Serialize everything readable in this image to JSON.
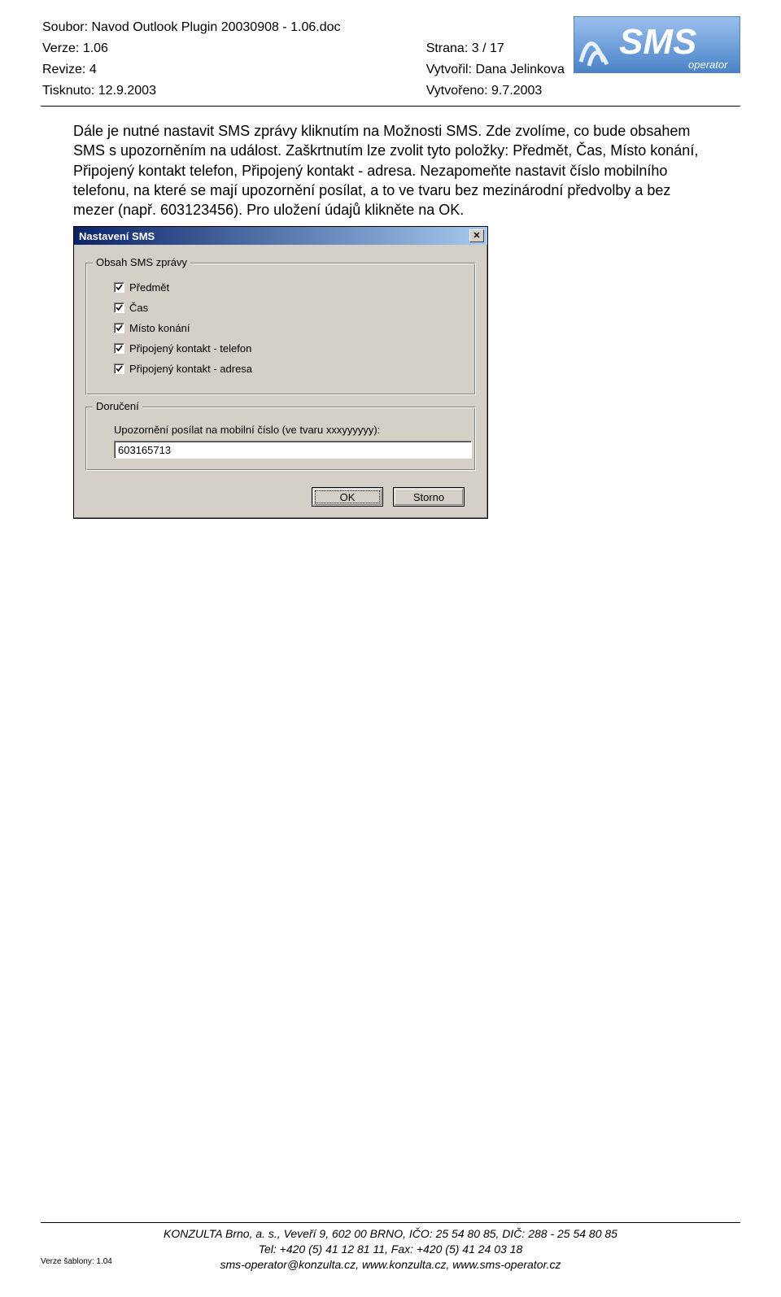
{
  "header": {
    "file_label": "Soubor:",
    "file_value": "Navod Outlook Plugin 20030908 - 1.06.doc",
    "version_label": "Verze:",
    "version_value": "1.06",
    "page_label": "Strana:",
    "page_value": "3 / 17",
    "revision_label": "Revize:",
    "revision_value": "4",
    "created_by_label": "Vytvořil:",
    "created_by_value": "Dana Jelinkova",
    "printed_label": "Tisknuto:",
    "printed_value": "12.9.2003",
    "created_label": "Vytvořeno:",
    "created_value": "9.7.2003",
    "logo_text_main": "SMS",
    "logo_text_sub": "operator"
  },
  "body": {
    "paragraph": "Dále je nutné nastavit SMS zprávy kliknutím na Možnosti SMS. Zde zvolíme, co bude obsahem SMS s upozorněním na událost. Zaškrtnutím lze zvolit tyto položky: Předmět, Čas, Místo konání, Připojený kontakt telefon, Připojený kontakt - adresa. Nezapomeňte nastavit číslo mobilního telefonu, na které se mají upozornění posílat, a to ve tvaru bez mezinárodní předvolby a bez mezer (např. 603123456). Pro uložení údajů klikněte na OK."
  },
  "dialog": {
    "title": "Nastavení SMS",
    "close_symbol": "✕",
    "group1_legend": "Obsah SMS zprávy",
    "checks": [
      {
        "label": "Předmět",
        "checked": true
      },
      {
        "label": "Čas",
        "checked": true
      },
      {
        "label": "Místo konání",
        "checked": true
      },
      {
        "label": "Připojený kontakt - telefon",
        "checked": true
      },
      {
        "label": "Připojený kontakt - adresa",
        "checked": true
      }
    ],
    "group2_legend": "Doručení",
    "phone_label": "Upozornění posílat na mobilní číslo (ve tvaru xxxyyyyyy):",
    "phone_value": "603165713",
    "ok_label": "OK",
    "cancel_label": "Storno"
  },
  "footer": {
    "template_version_label": "Verze šablony:",
    "template_version_value": "1.04",
    "line1": "KONZULTA Brno, a. s., Veveří 9, 602 00 BRNO, IČO: 25 54 80 85, DIČ: 288 - 25 54 80 85",
    "line2": "Tel: +420 (5) 41 12 81 11, Fax: +420 (5) 41 24 03 18",
    "line3": "sms-operator@konzulta.cz, www.konzulta.cz, www.sms-operator.cz"
  }
}
